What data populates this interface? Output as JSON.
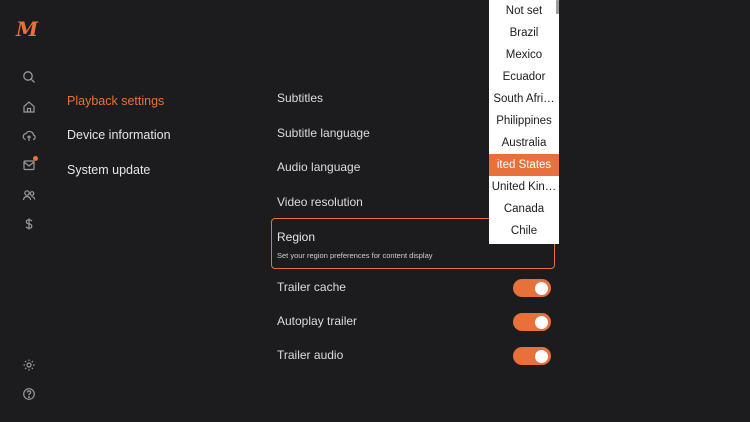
{
  "app": {
    "logo_text": "M"
  },
  "rail": {
    "icons": [
      "search-icon",
      "home-icon",
      "upload-icon",
      "inbox-icon",
      "users-icon",
      "dollar-icon",
      "settings-icon",
      "help-icon"
    ]
  },
  "categories": {
    "playback": "Playback settings",
    "device": "Device information",
    "system": "System update"
  },
  "settings": {
    "subtitles": "Subtitles",
    "subtitle_language": "Subtitle language",
    "audio_language": "Audio language",
    "video_resolution": "Video resolution",
    "region_title": "Region",
    "region_desc": "Set your region preferences for content display",
    "trailer_cache": "Trailer cache",
    "autoplay_trailer": "Autoplay trailer",
    "trailer_audio": "Trailer audio"
  },
  "toggles": {
    "trailer_cache_on": true,
    "autoplay_trailer_on": true,
    "trailer_audio_on": true
  },
  "region_dropdown": {
    "options": [
      "Not set",
      "Brazil",
      "Mexico",
      "Ecuador",
      "South Afri…",
      "Philippines",
      "Australia",
      "ited States",
      "United Kin…",
      "Canada",
      "Chile"
    ],
    "selected": "ited States"
  },
  "colors": {
    "accent": "#e8703a",
    "background": "#1c1c1e"
  }
}
